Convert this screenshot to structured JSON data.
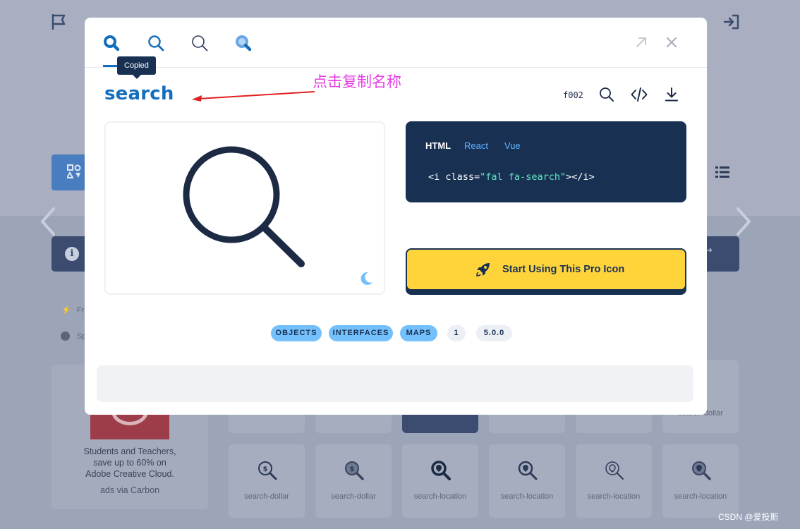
{
  "modal": {
    "style_tabs": [
      {
        "name": "solid",
        "selected": true
      },
      {
        "name": "regular"
      },
      {
        "name": "light"
      },
      {
        "name": "duotone"
      }
    ],
    "tooltip": "Copied",
    "icon_name": "search",
    "annotation": "点击复制名称",
    "unicode": "f002",
    "code_tabs": [
      "HTML",
      "React",
      "Vue"
    ],
    "code_active_tab": "HTML",
    "code": {
      "pre": "<i class=",
      "q1": "\"",
      "cls": "fal fa-search",
      "q2": "\"",
      "post": "></i>"
    },
    "cta_label": "Start Using This Pro Icon",
    "categories": [
      "OBJECTS",
      "INTERFACES",
      "MAPS"
    ],
    "badges": [
      "1",
      "5.0.0"
    ],
    "colors": {
      "primary": "#146ebe",
      "navy": "#183153",
      "yellow": "#ffd43b",
      "pill": "#74c0fc",
      "annotation": "#e63ee6"
    }
  },
  "background": {
    "ad": {
      "lines": [
        "Students and Teachers,",
        "save up to 60% on",
        "Adobe Creative Cloud."
      ],
      "via": "ads via Carbon"
    },
    "partial_labels": [
      "Fr",
      "Sp"
    ],
    "top_row_labels": [
      "search-dollar"
    ],
    "icon_grid": [
      {
        "label": "search-dollar"
      },
      {
        "label": "search-dollar"
      },
      {
        "label": "search-location"
      },
      {
        "label": "search-location"
      },
      {
        "label": "search-location"
      },
      {
        "label": "search-location"
      }
    ]
  },
  "watermark": "CSDN @爱投斯"
}
